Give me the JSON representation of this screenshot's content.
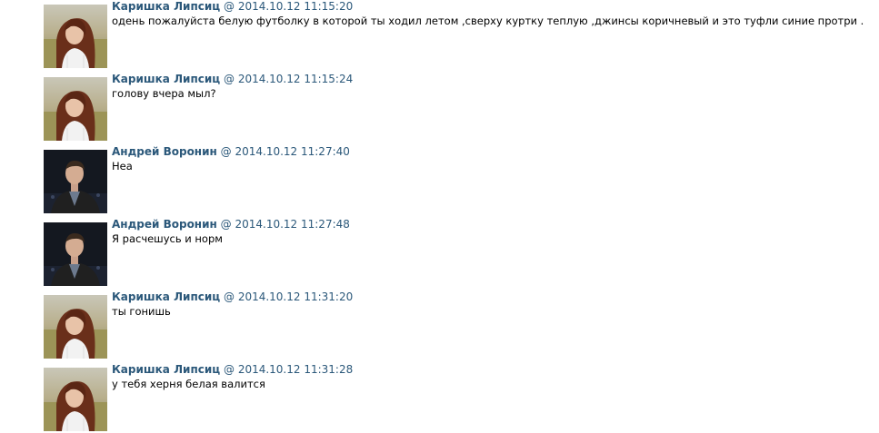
{
  "colors": {
    "author_link": "#2b587a",
    "timestamp": "#2b587a",
    "message_text": "#000000",
    "background": "#ffffff"
  },
  "messages": [
    {
      "author": "Каришка Липсиц",
      "separator": "@",
      "timestamp": "2014.10.12 11:15:20",
      "text": "одень пожалуйста белую футболку в которой ты ходил летом ,сверху куртку теплую ,джинсы коричневый и это туфли синие протри .",
      "avatar": "girl-photo"
    },
    {
      "author": "Каришка Липсиц",
      "separator": "@",
      "timestamp": "2014.10.12 11:15:24",
      "text": "голову вчера мыл?",
      "avatar": "girl-photo"
    },
    {
      "author": "Андрей Воронин",
      "separator": "@",
      "timestamp": "2014.10.12 11:27:40",
      "text": "Неа",
      "avatar": "boy-photo"
    },
    {
      "author": "Андрей Воронин",
      "separator": "@",
      "timestamp": "2014.10.12 11:27:48",
      "text": "Я расчешусь и норм",
      "avatar": "boy-photo"
    },
    {
      "author": "Каришка Липсиц",
      "separator": "@",
      "timestamp": "2014.10.12 11:31:20",
      "text": "ты гонишь",
      "avatar": "girl-photo"
    },
    {
      "author": "Каришка Липсиц",
      "separator": "@",
      "timestamp": "2014.10.12 11:31:28",
      "text": "у тебя херня белая валится",
      "avatar": "girl-photo"
    }
  ]
}
